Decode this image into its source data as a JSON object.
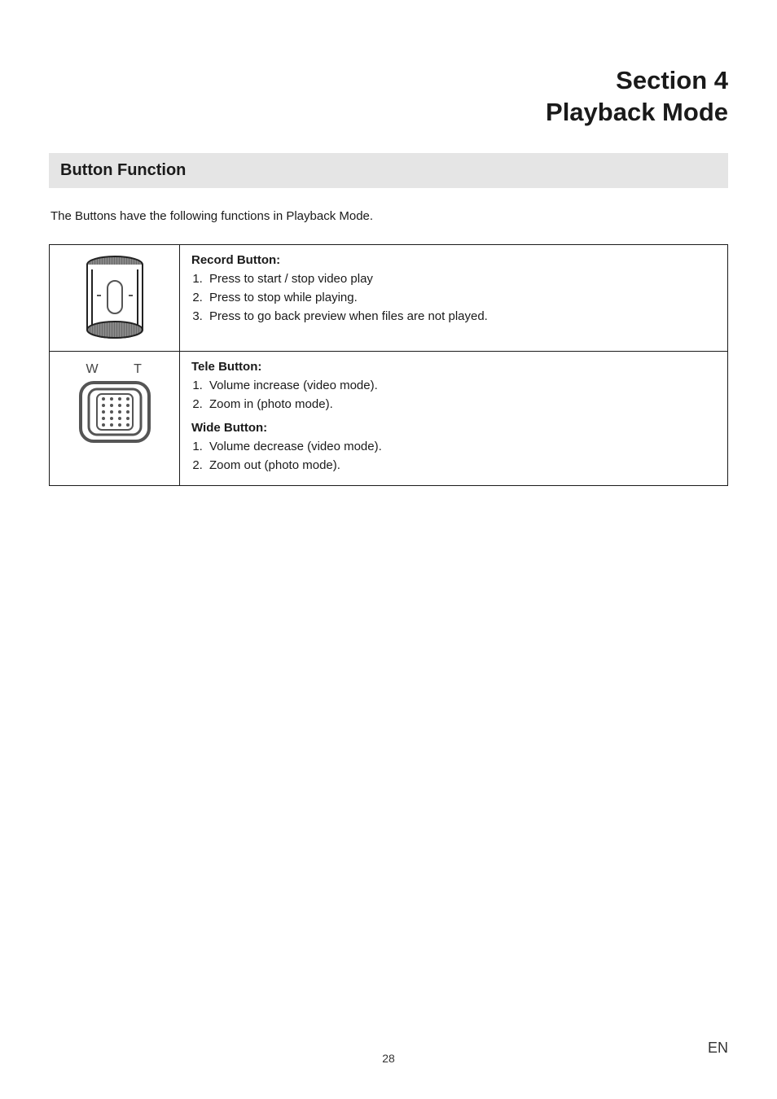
{
  "header": {
    "line1": "Section 4",
    "line2": "Playback Mode"
  },
  "subsection": "Button Function",
  "description": "The Buttons have the following functions in Playback Mode.",
  "rows": [
    {
      "title": "Record Button:",
      "items": [
        "Press to start / stop video play",
        "Press to stop while playing.",
        "Press to go back preview when files are not played."
      ]
    },
    {
      "tele_title": "Tele Button:",
      "tele_items": [
        "Volume increase (video mode).",
        "Zoom in (photo mode)."
      ],
      "wide_title": "Wide Button:",
      "wide_items": [
        "Volume decrease (video mode).",
        "Zoom out (photo mode)."
      ],
      "labels": {
        "w": "W",
        "t": "T"
      }
    }
  ],
  "footer": {
    "page": "28",
    "lang": "EN"
  }
}
